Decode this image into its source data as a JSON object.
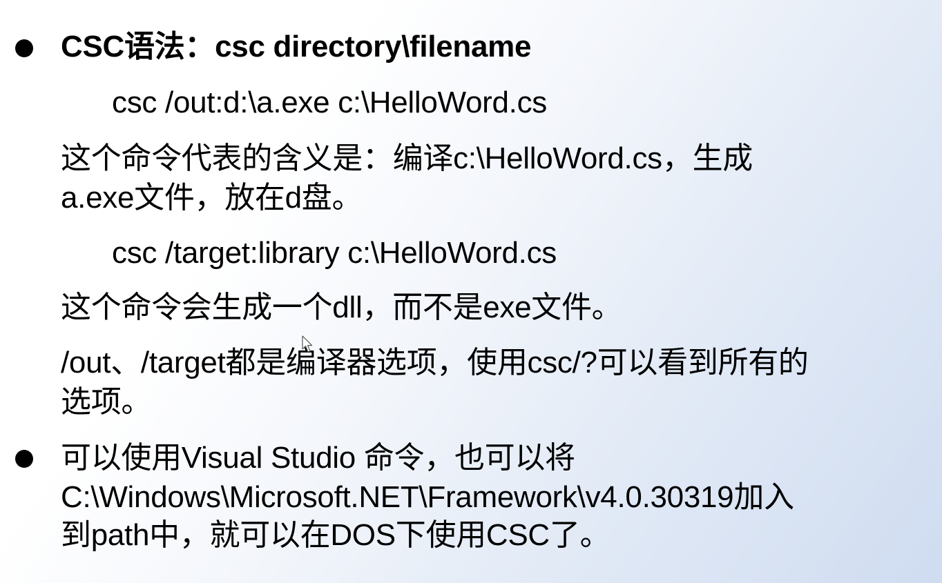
{
  "slide": {
    "bullet1": {
      "heading": "CSC语法：csc directory\\filename",
      "example1_cmd": "csc /out:d:\\a.exe  c:\\HelloWord.cs",
      "example1_desc_line1": "这个命令代表的含义是：编译c:\\HelloWord.cs，生成",
      "example1_desc_line2": "a.exe文件，放在d盘。",
      "example2_cmd": "csc /target:library  c:\\HelloWord.cs",
      "example2_desc": "这个命令会生成一个dll，而不是exe文件。",
      "options_line1": "/out、/target都是编译器选项，使用csc/?可以看到所有的",
      "options_line2": "选项。"
    },
    "bullet2": {
      "line1": "可以使用Visual Studio 命令，也可以将",
      "line2": "C:\\Windows\\Microsoft.NET\\Framework\\v4.0.30319加入",
      "line3": "到path中，就可以在DOS下使用CSC了。"
    }
  },
  "colors": {
    "text": "#000000",
    "background_start": "#ffffff",
    "background_end": "#cfdcf0"
  },
  "icons": {
    "bullet": "bullet-dot-icon",
    "cursor": "mouse-cursor-icon"
  }
}
